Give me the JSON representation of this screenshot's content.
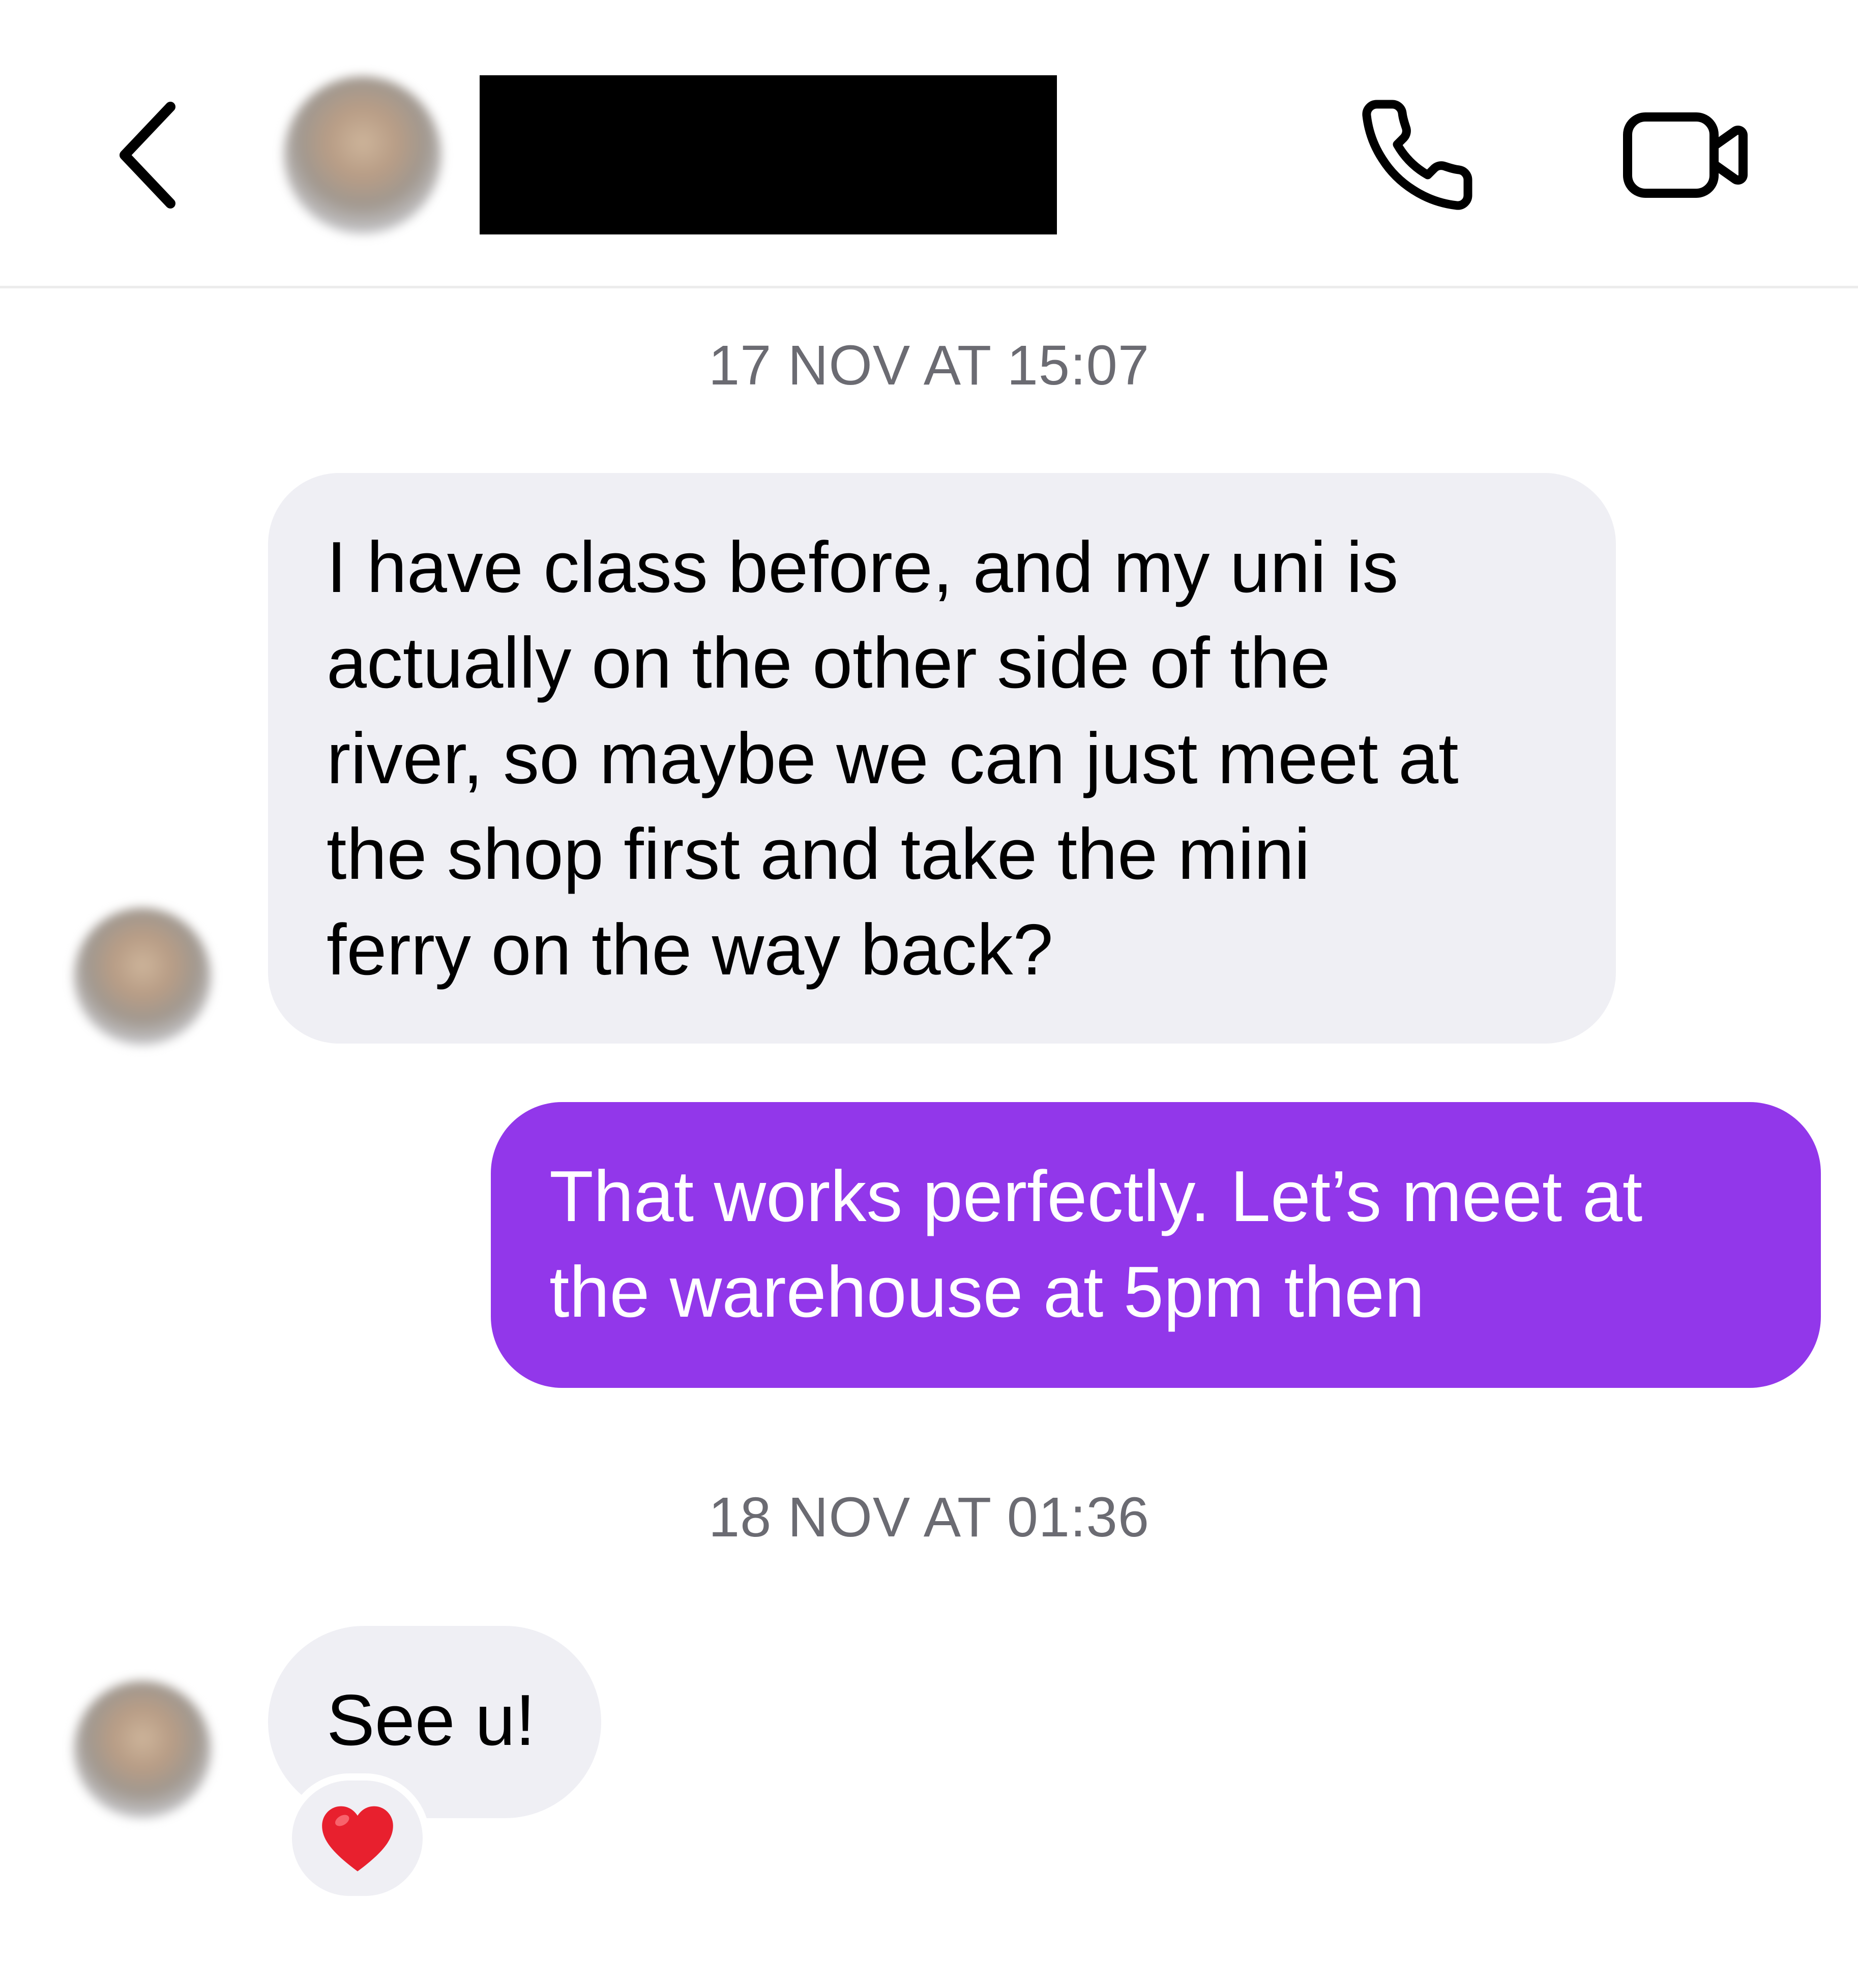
{
  "header": {
    "contact_name_redacted": "",
    "icons": {
      "back": "chevron-left-icon",
      "call": "phone-icon",
      "video": "video-camera-icon"
    }
  },
  "timestamps": [
    "17 NOV AT 15:07",
    "18 NOV AT 01:36"
  ],
  "messages": [
    {
      "direction": "incoming",
      "lines": [
        "I have class before, and my uni is",
        "actually on the other side of the",
        "river, so maybe we can just meet at",
        "the shop first and take the mini",
        "ferry on the way back?"
      ]
    },
    {
      "direction": "outgoing",
      "lines": [
        "That works perfectly. Let’s meet at",
        "the warehouse at 5pm then"
      ]
    },
    {
      "direction": "incoming",
      "lines": [
        "See u!"
      ],
      "reaction": "heart-icon"
    }
  ],
  "colors": {
    "outgoing_bubble": "#9237ea",
    "incoming_bubble": "#efeff4",
    "timestamp_text": "#6b6b72",
    "reaction_heart": "#e8202e"
  }
}
